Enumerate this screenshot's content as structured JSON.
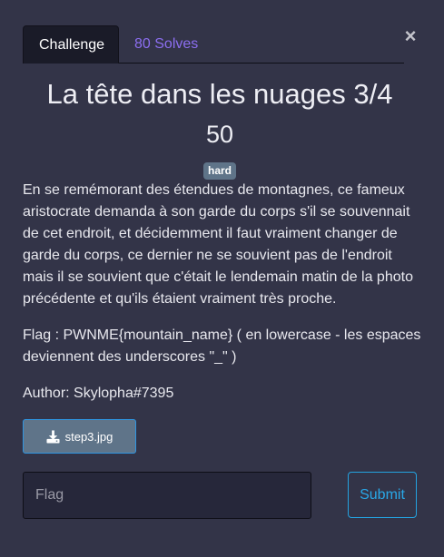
{
  "tabs": [
    {
      "label": "Challenge",
      "active": true
    },
    {
      "label": "80 Solves",
      "active": false
    }
  ],
  "close_icon": "close-icon",
  "challenge": {
    "title": "La tête dans les nuages 3/4",
    "points": "50",
    "difficulty": "hard",
    "description": "En se remémorant des étendues de montagnes, ce fameux aristocrate demanda à son garde du corps s'il se souvennait de cet endroit, et décidemment il faut vraiment changer de garde du corps, ce dernier ne se souvient pas de l'endroit mais il se souvient que c'était le lendemain matin de la photo précédente et qu'ils étaient vraiment très proche.",
    "flag_format": "Flag : PWNME{mountain_name} ( en lowercase - les espaces deviennent des underscores \"_\" )",
    "author": "Author: Skylopha#7395"
  },
  "file": {
    "label": "step3.jpg",
    "icon": "download-icon"
  },
  "form": {
    "flag_placeholder": "Flag",
    "flag_value": "",
    "submit_label": "Submit"
  },
  "colors": {
    "background": "#333448",
    "active_tab": "#1a1b28",
    "solves_link": "#8c6ef0",
    "badge": "#5f7489",
    "submit_accent": "#29a8e8"
  }
}
